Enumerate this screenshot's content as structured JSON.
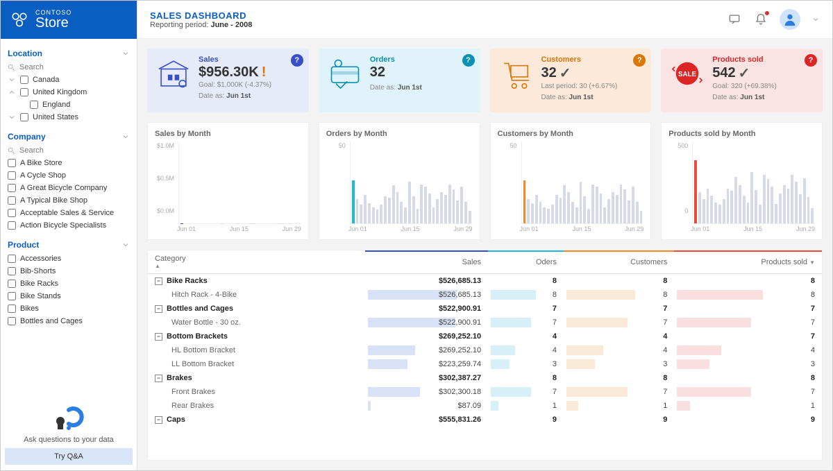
{
  "brand": {
    "top": "CONTOSO",
    "name": "Store"
  },
  "header": {
    "title": "SALES DASHBOARD",
    "subtitle_prefix": "Reporting period: ",
    "period": "June - 2008"
  },
  "sidebar": {
    "location": {
      "label": "Location",
      "search": "Search",
      "items": [
        {
          "label": "Canada",
          "chev": "down"
        },
        {
          "label": "United Kingdom",
          "chev": "up",
          "children": [
            {
              "label": "England"
            }
          ]
        },
        {
          "label": "United States",
          "chev": "down"
        }
      ]
    },
    "company": {
      "label": "Company",
      "search": "Search",
      "items": [
        "A Bike Store",
        "A Cycle Shop",
        "A Great Bicycle Company",
        "A Typical Bike Shop",
        "Acceptable Sales & Service",
        "Action Bicycle Specialists"
      ]
    },
    "product": {
      "label": "Product",
      "items": [
        "Accessories",
        "Bib-Shorts",
        "Bike Racks",
        "Bike Stands",
        "Bikes",
        "Bottles and Cages"
      ]
    },
    "qna": {
      "text": "Ask questions to your data",
      "button": "Try Q&A"
    }
  },
  "kpis": [
    {
      "label": "Sales",
      "value": "$956.30K",
      "indicator": "!",
      "goal": "Goal: $1,000K (-4.37%)",
      "date": "Jun 1st",
      "color": "blue"
    },
    {
      "label": "Orders",
      "value": "32",
      "indicator": "",
      "goal": "",
      "date": "Jun 1st",
      "color": "cyan"
    },
    {
      "label": "Customers",
      "value": "32",
      "indicator": "✓",
      "goal": "Last period: 30 (+6.67%)",
      "date": "Jun 1st",
      "color": "orange"
    },
    {
      "label": "Products sold",
      "value": "542",
      "indicator": "✓",
      "goal": "Goal: 320 (+69.38%)",
      "date": "Jun 1st",
      "color": "red"
    }
  ],
  "kpi_date_prefix": "Date as: ",
  "table": {
    "columns": [
      "Category",
      "Sales",
      "Oders",
      "Customers",
      "Products sold"
    ],
    "rows": [
      {
        "type": "group",
        "cat": "Bike Racks",
        "sales": "$526,685.13",
        "orders": "8",
        "cust": "8",
        "prod": "8"
      },
      {
        "type": "item",
        "cat": "Hitch Rack - 4-Bike",
        "sales": "$526,685.13",
        "orders": "8",
        "cust": "8",
        "prod": "8",
        "bars": [
          72,
          60,
          62,
          58
        ]
      },
      {
        "type": "group",
        "cat": "Bottles and Cages",
        "sales": "$522,900.91",
        "orders": "7",
        "cust": "7",
        "prod": "7"
      },
      {
        "type": "item",
        "cat": "Water Bottle - 30 oz.",
        "sales": "$522,900.91",
        "orders": "7",
        "cust": "7",
        "prod": "7",
        "bars": [
          71,
          53,
          55,
          50
        ]
      },
      {
        "type": "group",
        "cat": "Bottom Brackets",
        "sales": "$269,252.10",
        "orders": "4",
        "cust": "4",
        "prod": "7"
      },
      {
        "type": "item",
        "cat": "HL Bottom Bracket",
        "sales": "$269,252.10",
        "orders": "4",
        "cust": "4",
        "prod": "4",
        "bars": [
          38,
          32,
          33,
          30
        ]
      },
      {
        "type": "item",
        "cat": "LL Bottom Bracket",
        "sales": "$223,259.74",
        "orders": "3",
        "cust": "3",
        "prod": "3",
        "bars": [
          32,
          25,
          26,
          22
        ]
      },
      {
        "type": "group",
        "cat": "Brakes",
        "sales": "$302,387.27",
        "orders": "8",
        "cust": "8",
        "prod": "8"
      },
      {
        "type": "item",
        "cat": "Front Brakes",
        "sales": "$302,300.18",
        "orders": "7",
        "cust": "7",
        "prod": "7",
        "bars": [
          42,
          53,
          55,
          50
        ]
      },
      {
        "type": "item",
        "cat": "Rear Brakes",
        "sales": "$87.09",
        "orders": "1",
        "cust": "1",
        "prod": "1",
        "bars": [
          2,
          10,
          11,
          9
        ]
      },
      {
        "type": "group",
        "cat": "Caps",
        "sales": "$555,831.26",
        "orders": "9",
        "cust": "9",
        "prod": "9"
      }
    ]
  },
  "chart_data": [
    {
      "title": "Sales by Month",
      "type": "bar",
      "color": "blue",
      "ylabel": "",
      "ylim": [
        0,
        1000000
      ],
      "yticks": [
        "$1.0M",
        "$0.5M",
        "$0.0M"
      ],
      "xticks": [
        "Jun 01",
        "Jun 15",
        "Jun 29"
      ],
      "highlight_index": 0,
      "values": [
        956,
        420,
        380,
        440,
        360,
        300,
        280,
        340,
        450,
        420,
        560,
        480,
        360,
        300,
        610,
        430,
        280,
        580,
        530,
        450,
        280,
        390,
        470,
        430,
        580,
        520,
        380,
        540,
        360,
        200
      ]
    },
    {
      "title": "Orders by Month",
      "type": "bar",
      "color": "cyan",
      "ylabel": "",
      "ylim": [
        0,
        60
      ],
      "yticks": [
        "50",
        ""
      ],
      "xticks": [
        "Jun 01",
        "Jun 15",
        "Jun 29"
      ],
      "highlight_index": 0,
      "values": [
        32,
        18,
        14,
        21,
        15,
        12,
        10,
        14,
        20,
        19,
        28,
        23,
        16,
        12,
        31,
        20,
        11,
        29,
        27,
        22,
        12,
        18,
        23,
        21,
        29,
        25,
        17,
        27,
        16,
        9
      ]
    },
    {
      "title": "Customers by Month",
      "type": "bar",
      "color": "orange",
      "ylabel": "",
      "ylim": [
        0,
        60
      ],
      "yticks": [
        "50",
        ""
      ],
      "xticks": [
        "Jun 01",
        "Jun 15",
        "Jun 29"
      ],
      "highlight_index": 0,
      "values": [
        32,
        18,
        15,
        21,
        16,
        12,
        11,
        14,
        21,
        19,
        28,
        23,
        16,
        12,
        31,
        20,
        11,
        29,
        27,
        22,
        12,
        18,
        23,
        21,
        29,
        25,
        17,
        27,
        16,
        9
      ]
    },
    {
      "title": "Products sold by Month",
      "type": "bar",
      "color": "red",
      "ylabel": "",
      "ylim": [
        0,
        700
      ],
      "yticks": [
        "500",
        "0"
      ],
      "xticks": [
        "Jun 01",
        "Jun 15",
        "Jun 29"
      ],
      "highlight_index": 0,
      "values": [
        542,
        270,
        210,
        300,
        240,
        180,
        160,
        210,
        300,
        280,
        400,
        330,
        240,
        180,
        440,
        290,
        160,
        420,
        380,
        320,
        170,
        260,
        330,
        300,
        420,
        360,
        250,
        390,
        230,
        130
      ]
    }
  ]
}
